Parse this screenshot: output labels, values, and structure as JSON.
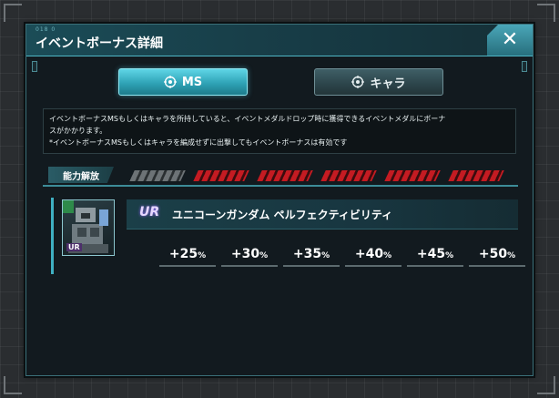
{
  "dialog": {
    "code": "018 0",
    "title": "イベントボーナス詳細",
    "close_icon": "close-icon"
  },
  "tabs": [
    {
      "label": "MS",
      "icon": "target-icon",
      "active": true
    },
    {
      "label": "キャラ",
      "icon": "target-icon",
      "active": false
    }
  ],
  "description": {
    "line1": "イベントボーナスMSもしくはキャラを所持していると、イベントメダルドロップ時に獲得できるイベントメダルにボーナ",
    "line2": "スがかかります。",
    "line3": "*イベントボーナスMSもしくはキャラを編成せずに出撃してもイベントボーナスは有効です"
  },
  "unlock": {
    "label": "能力解放",
    "slots": [
      "locked",
      "unlocked",
      "unlocked",
      "unlocked",
      "unlocked",
      "unlocked"
    ]
  },
  "unit": {
    "rarity": "UR",
    "name": "ユニコーンガンダム ペルフェクティビリティ",
    "bonuses": [
      {
        "value": "+25",
        "unit": "%"
      },
      {
        "value": "+30",
        "unit": "%"
      },
      {
        "value": "+35",
        "unit": "%"
      },
      {
        "value": "+40",
        "unit": "%"
      },
      {
        "value": "+45",
        "unit": "%"
      },
      {
        "value": "+50",
        "unit": "%"
      }
    ]
  },
  "colors": {
    "accent": "#3fb0c2",
    "active_tab": "#2fa3b6",
    "unlock_red": "#c41b22"
  }
}
